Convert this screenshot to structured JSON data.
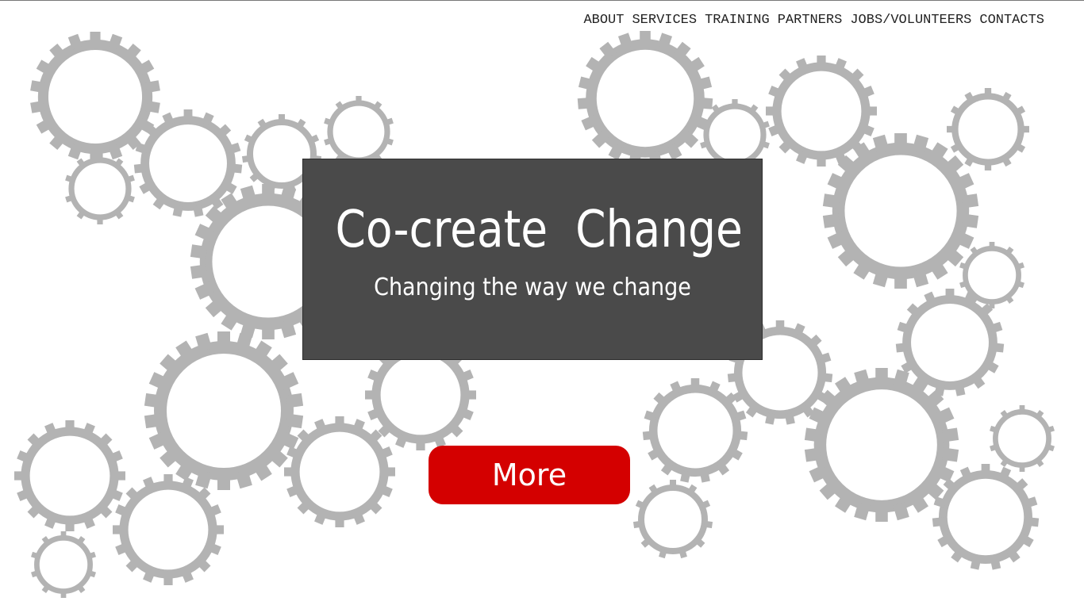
{
  "nav": {
    "items": [
      "ABOUT",
      "SERVICES",
      "TRAINING",
      "PARTNERS",
      "JOBS/VOLUNTEERS",
      "CONTACTS"
    ]
  },
  "hero": {
    "title": "Co-create  Change",
    "subtitle": "Changing the way we change"
  },
  "cta": {
    "more_label": "More"
  },
  "colors": {
    "gear": "#b3b3b3",
    "hero_bg": "#4a4a4a",
    "cta_bg": "#d40000"
  },
  "icons": [
    "gear-icon"
  ]
}
